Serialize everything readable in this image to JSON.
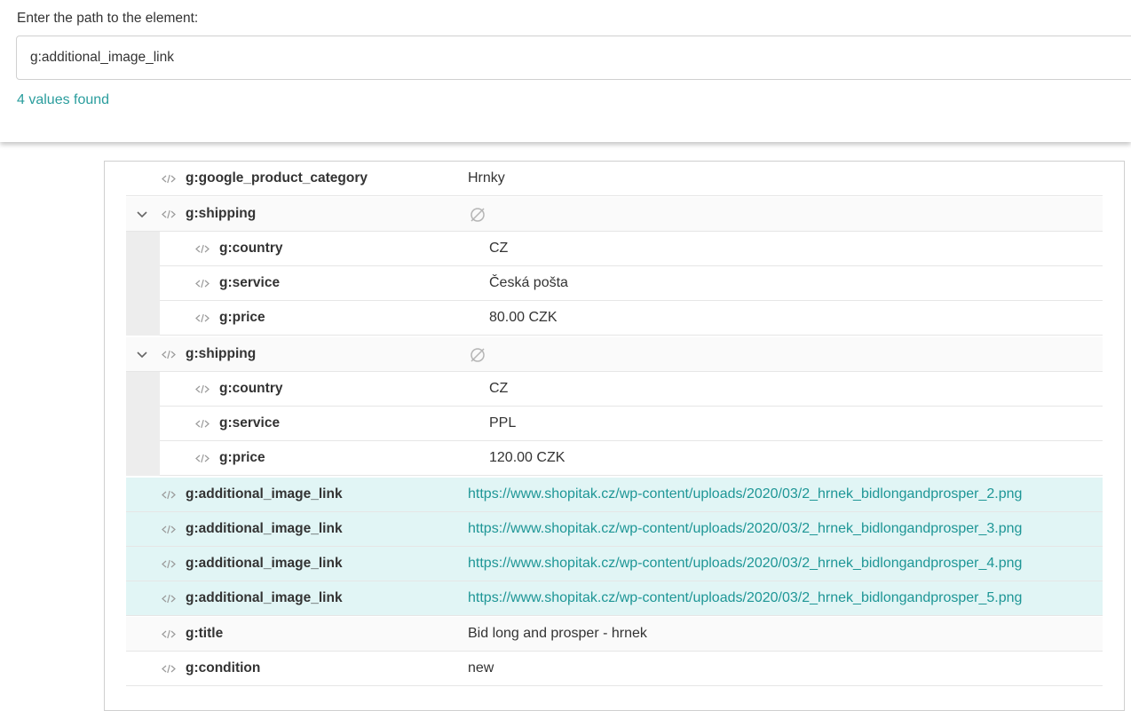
{
  "search": {
    "label": "Enter the path to the element:",
    "value": "g:additional_image_link",
    "result": "4 values found"
  },
  "tree": {
    "rows": [
      {
        "key": "g:google_product_category",
        "value": "Hrnky"
      },
      {
        "key": "g:shipping",
        "value_icon": "null-icon",
        "expanded": true
      },
      {
        "key": "g:country",
        "value": "CZ"
      },
      {
        "key": "g:service",
        "value": "Česká pošta"
      },
      {
        "key": "g:price",
        "value": "80.00 CZK"
      },
      {
        "key": "g:shipping",
        "value_icon": "null-icon",
        "expanded": true
      },
      {
        "key": "g:country",
        "value": "CZ"
      },
      {
        "key": "g:service",
        "value": "PPL"
      },
      {
        "key": "g:price",
        "value": "120.00 CZK"
      },
      {
        "key": "g:additional_image_link",
        "value": "https://www.shopitak.cz/wp-content/uploads/2020/03/2_hrnek_bidlongandprosper_2.png",
        "highlighted": true
      },
      {
        "key": "g:additional_image_link",
        "value": "https://www.shopitak.cz/wp-content/uploads/2020/03/2_hrnek_bidlongandprosper_3.png",
        "highlighted": true
      },
      {
        "key": "g:additional_image_link",
        "value": "https://www.shopitak.cz/wp-content/uploads/2020/03/2_hrnek_bidlongandprosper_4.png",
        "highlighted": true
      },
      {
        "key": "g:additional_image_link",
        "value": "https://www.shopitak.cz/wp-content/uploads/2020/03/2_hrnek_bidlongandprosper_5.png",
        "highlighted": true
      },
      {
        "key": "g:title",
        "value": "Bid long and prosper - hrnek"
      },
      {
        "key": "g:condition",
        "value": "new"
      }
    ]
  },
  "colors": {
    "accent": "#2a9d9d",
    "highlight_row": "#e1f5f5"
  }
}
